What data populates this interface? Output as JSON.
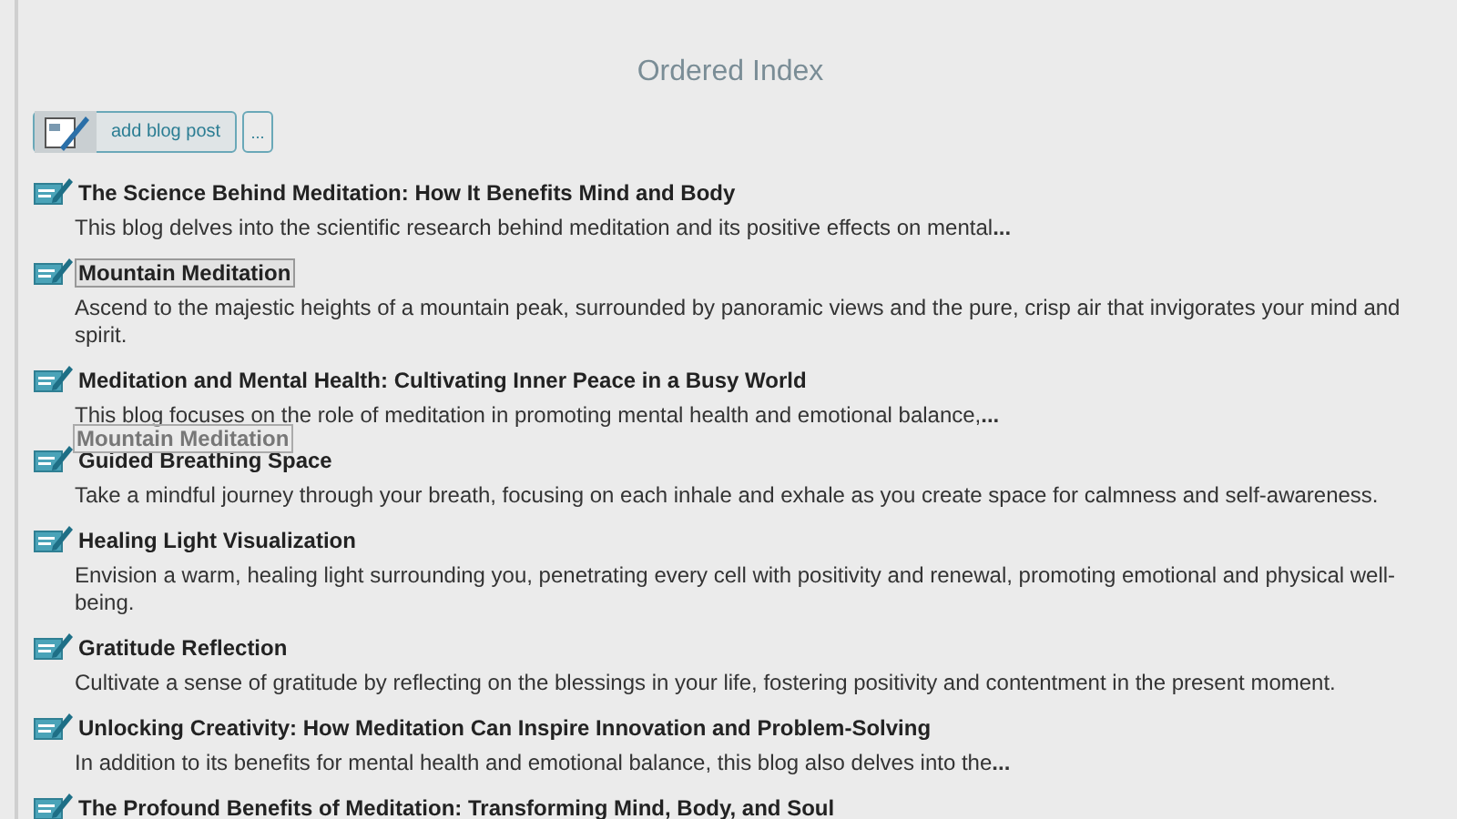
{
  "title": "Ordered Index",
  "toolbar": {
    "add_button": "add blog post",
    "more_button": "..."
  },
  "posts": [
    {
      "title": "The Science Behind Meditation: How It Benefits Mind and Body",
      "description": "This blog delves into the scientific research behind meditation and its positive effects on mental**...**",
      "selected": false
    },
    {
      "title": "Mountain Meditation",
      "description": "Ascend to the majestic heights of a mountain peak, surrounded by panoramic views and the pure, crisp air that invigorates your mind and spirit.",
      "selected": true
    },
    {
      "title": "Meditation and Mental Health: Cultivating Inner Peace in a Busy World",
      "description": "This blog focuses on the role of meditation in promoting mental health and emotional balance,**...**",
      "selected": false
    },
    {
      "title": "Guided Breathing Space",
      "description": "Take a mindful journey through your breath, focusing on each inhale and exhale as you create space for calmness and self-awareness.",
      "selected": false
    },
    {
      "title": "Healing Light Visualization",
      "description": "Envision a warm, healing light surrounding you, penetrating every cell with positivity and renewal, promoting emotional and physical well-being.",
      "selected": false
    },
    {
      "title": "Gratitude Reflection",
      "description": "Cultivate a sense of gratitude by reflecting on the blessings in your life, fostering positivity and contentment in the present moment.",
      "selected": false
    },
    {
      "title": "Unlocking Creativity: How Meditation Can Inspire Innovation and Problem-Solving",
      "description": "In addition to its benefits for mental health and emotional balance, this blog also delves into the**...**",
      "selected": false
    },
    {
      "title": "The Profound Benefits of Meditation: Transforming Mind, Body, and Soul",
      "selected": false
    }
  ],
  "drag_ghost": "Mountain Meditation"
}
